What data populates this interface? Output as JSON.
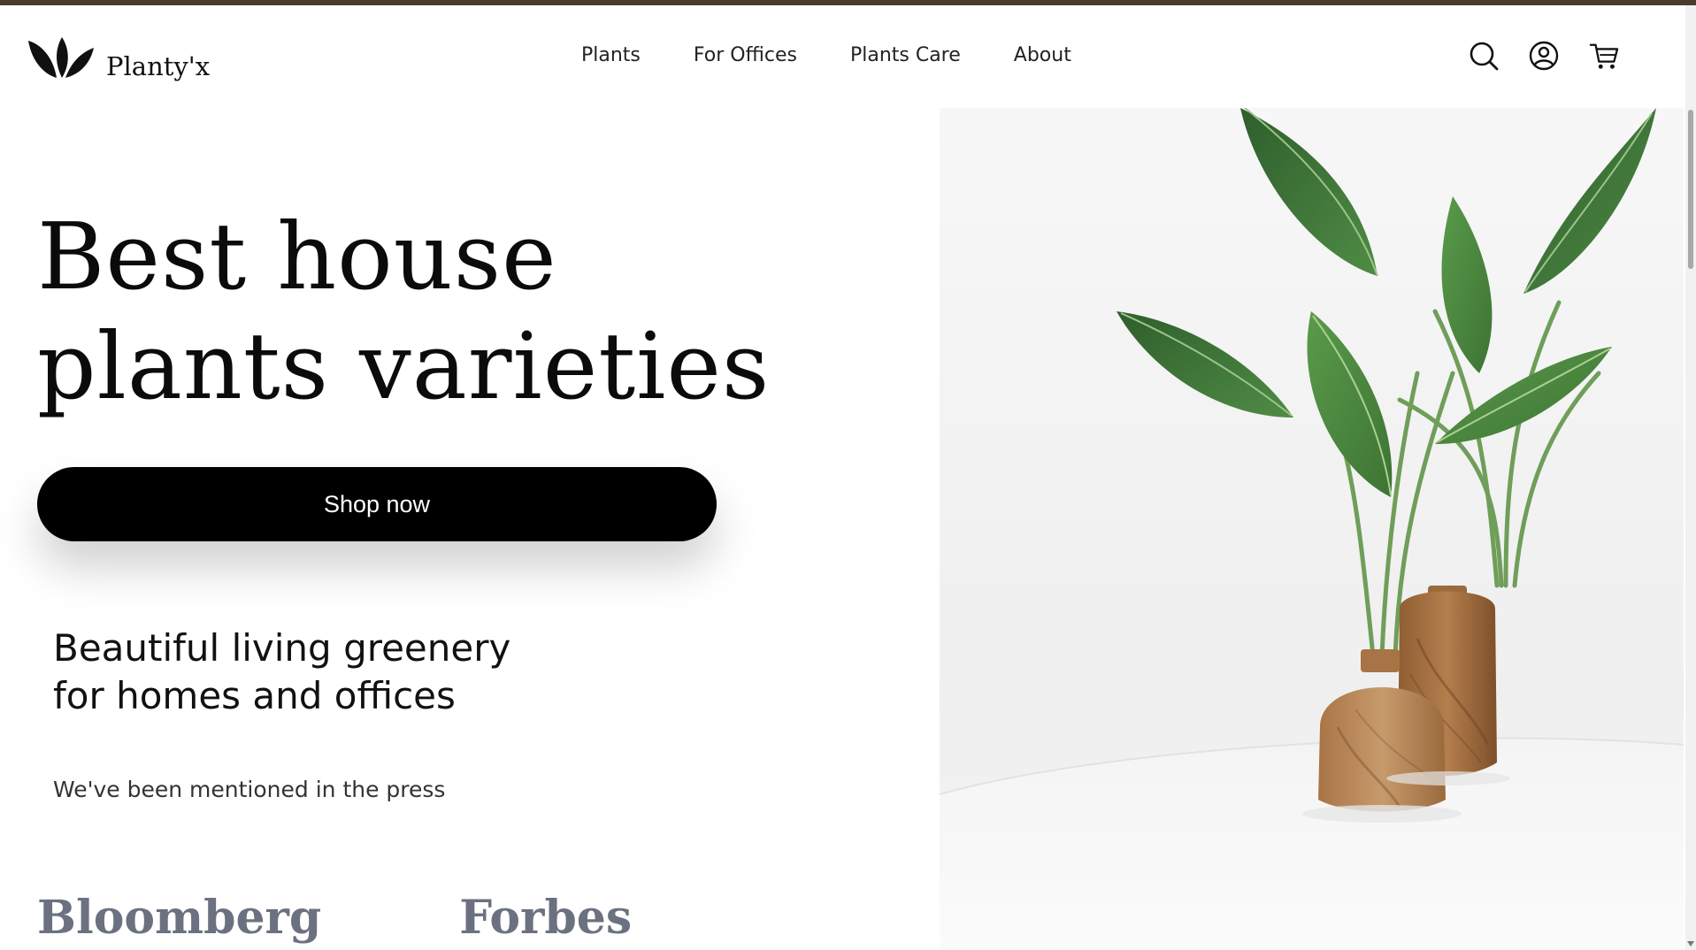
{
  "header": {
    "brand": "Planty'x",
    "nav": [
      {
        "label": "Plants"
      },
      {
        "label": "For Offices"
      },
      {
        "label": "Plants Care"
      },
      {
        "label": "About"
      }
    ],
    "icons": [
      "search-icon",
      "account-icon",
      "cart-icon"
    ]
  },
  "hero": {
    "title_line1": "Best house",
    "title_line2": "plants varieties",
    "cta_label": "Shop now",
    "tagline_line1": "Beautiful living greenery",
    "tagline_line2": "for homes and offices",
    "press_note": "We've been mentioned in the press",
    "press_logos": [
      "Bloomberg",
      "Forbes"
    ]
  },
  "colors": {
    "top_strip": "#4a3b2a",
    "cta_background": "#000000",
    "press_logo": "#6b7180",
    "leaf_green": "#3f7a3a",
    "wood": "#b98855"
  }
}
